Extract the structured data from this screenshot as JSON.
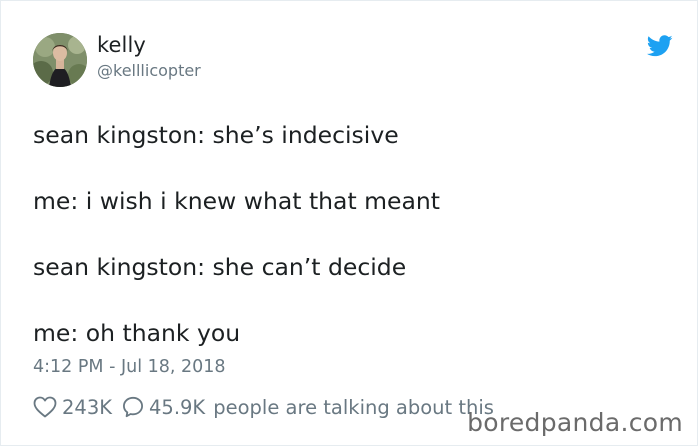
{
  "tweet": {
    "author": {
      "name": "kelly",
      "handle": "@kelllicopter",
      "avatar_icon": "profile-photo"
    },
    "brand_icon": "twitter-bird-icon",
    "brand_color": "#1da1f2",
    "lines": [
      "sean kingston: she’s indecisive",
      "me: i wish i knew what that meant",
      "sean kingston: she can’t decide",
      "me: oh thank you"
    ],
    "timestamp": "4:12 PM - Jul 18, 2018",
    "stats": {
      "likes": "243K",
      "replies": "45.9K",
      "talking_label": "people are talking about this"
    }
  },
  "watermark": "boredpanda.com"
}
